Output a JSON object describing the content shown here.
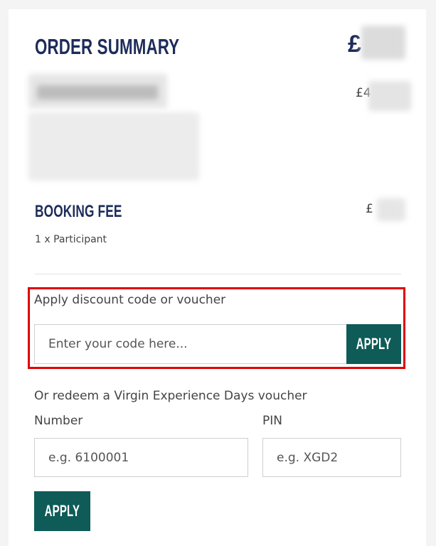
{
  "summary": {
    "title": "ORDER SUMMARY",
    "total_symbol": "£"
  },
  "item": {
    "price_symbol": "£4"
  },
  "booking_fee": {
    "title": "BOOKING FEE",
    "subtitle": "1 x Participant",
    "price_symbol": "£"
  },
  "discount": {
    "label": "Apply discount code or voucher",
    "placeholder": "Enter your code here...",
    "apply_label": "APPLY"
  },
  "voucher": {
    "label": "Or redeem a Virgin Experience Days voucher",
    "number_label": "Number",
    "number_placeholder": "e.g. 6100001",
    "pin_label": "PIN",
    "pin_placeholder": "e.g. XGD2",
    "apply_label": "APPLY"
  }
}
